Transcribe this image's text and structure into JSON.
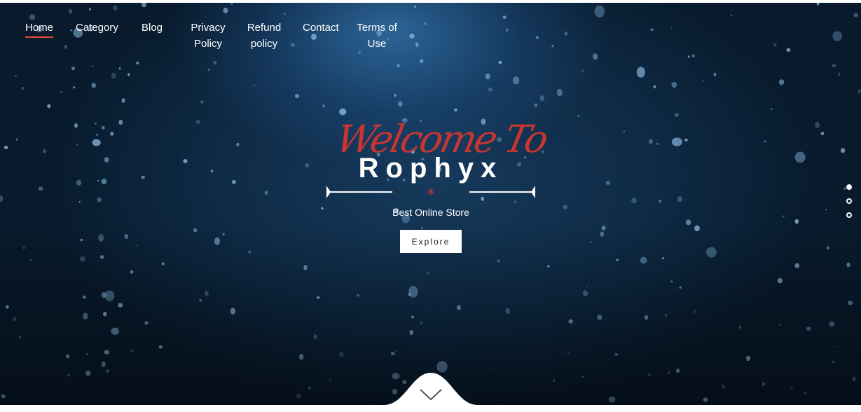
{
  "nav": {
    "items": [
      {
        "label": "Home",
        "active": true
      },
      {
        "label": "Category"
      },
      {
        "label": "Blog"
      },
      {
        "label": "Privacy\nPolicy"
      },
      {
        "label": "Refund\npolicy"
      },
      {
        "label": "Contact"
      },
      {
        "label": "Terms of\nUse"
      }
    ]
  },
  "hero": {
    "welcome": "Welcome To",
    "brand": "Rophyx",
    "subtitle": "Best Online Store",
    "explore_label": "Explore",
    "divider_mark": "*"
  },
  "slider": {
    "slide_count": 3,
    "active_index": 0
  },
  "colors": {
    "accent": "#c8362f",
    "nav_underline": "#e04e39",
    "text": "#ffffff"
  },
  "icons": {
    "scroll_down": "chevron-down-icon"
  }
}
